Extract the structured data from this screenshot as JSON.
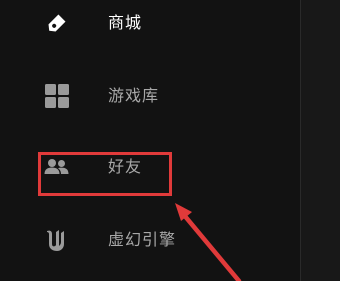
{
  "sidebar": {
    "items": [
      {
        "label": "商城",
        "icon": "tag-icon",
        "active": true
      },
      {
        "label": "游戏库",
        "icon": "grid-icon",
        "active": false
      },
      {
        "label": "好友",
        "icon": "friends-icon",
        "active": false
      },
      {
        "label": "虚幻引擎",
        "icon": "unreal-engine-icon",
        "active": false
      }
    ]
  },
  "annotation": {
    "color": "#e03a3a",
    "target": "好友"
  }
}
